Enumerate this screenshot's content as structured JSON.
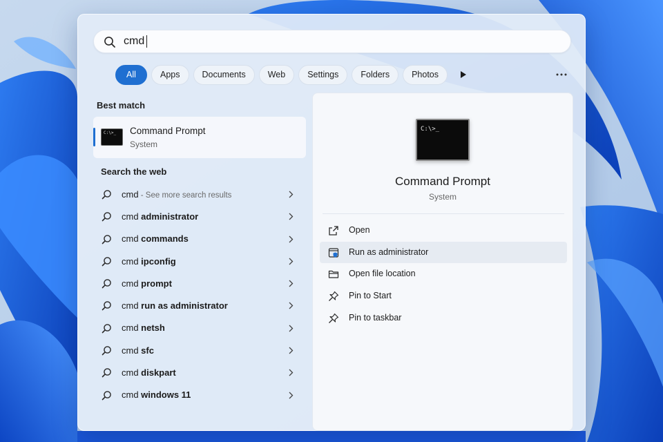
{
  "search": {
    "query": "cmd"
  },
  "filters": {
    "items": [
      {
        "label": "All",
        "active": true
      },
      {
        "label": "Apps",
        "active": false
      },
      {
        "label": "Documents",
        "active": false
      },
      {
        "label": "Web",
        "active": false
      },
      {
        "label": "Settings",
        "active": false
      },
      {
        "label": "Folders",
        "active": false
      },
      {
        "label": "Photos",
        "active": false
      }
    ],
    "more_icon": "play-icon",
    "overflow_icon": "ellipsis-icon"
  },
  "best_match": {
    "section_title": "Best match",
    "title": "Command Prompt",
    "subtitle": "System",
    "icon": "terminal-icon",
    "icon_text": "C:\\>_"
  },
  "web": {
    "section_title": "Search the web",
    "items": [
      {
        "prefix": "cmd",
        "bold": "",
        "hint": " - See more search results"
      },
      {
        "prefix": "cmd ",
        "bold": "administrator",
        "hint": ""
      },
      {
        "prefix": "cmd ",
        "bold": "commands",
        "hint": ""
      },
      {
        "prefix": "cmd ",
        "bold": "ipconfig",
        "hint": ""
      },
      {
        "prefix": "cmd ",
        "bold": "prompt",
        "hint": ""
      },
      {
        "prefix": "cmd ",
        "bold": "run as administrator",
        "hint": ""
      },
      {
        "prefix": "cmd ",
        "bold": "netsh",
        "hint": ""
      },
      {
        "prefix": "cmd ",
        "bold": "sfc",
        "hint": ""
      },
      {
        "prefix": "cmd ",
        "bold": "diskpart",
        "hint": ""
      },
      {
        "prefix": "cmd ",
        "bold": "windows 11",
        "hint": ""
      }
    ]
  },
  "preview": {
    "title": "Command Prompt",
    "subtitle": "System",
    "icon_text": "C:\\>_",
    "actions": [
      {
        "label": "Open",
        "icon": "open-external-icon"
      },
      {
        "label": "Run as administrator",
        "icon": "shield-icon"
      },
      {
        "label": "Open file location",
        "icon": "folder-icon"
      },
      {
        "label": "Pin to Start",
        "icon": "pin-icon"
      },
      {
        "label": "Pin to taskbar",
        "icon": "pin-icon"
      }
    ],
    "highlighted_action": "Run as administrator"
  },
  "colors": {
    "accent": "#1f6fd1",
    "wallpaper_blue": "#1652d6",
    "panel": "#e2ecf8"
  }
}
